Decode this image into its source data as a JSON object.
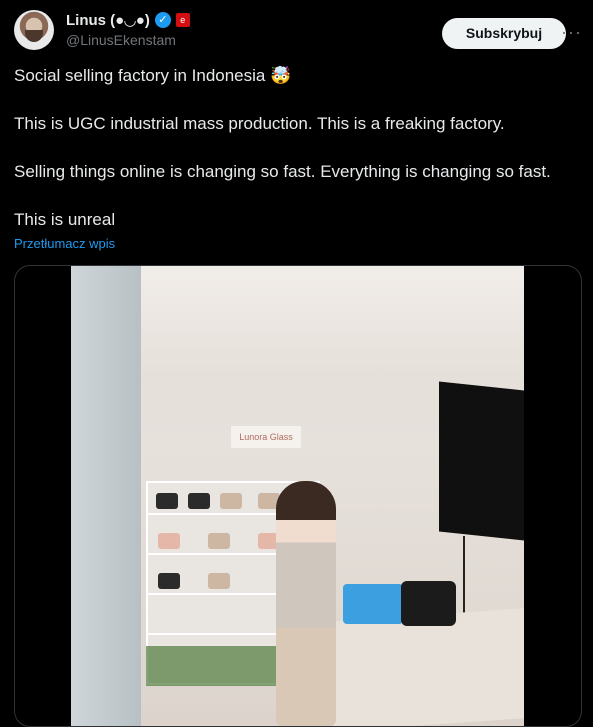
{
  "post": {
    "author_name": "Linus (●◡●)",
    "handle": "@LinusEkenstam",
    "subscribe_label": "Subskrybuj",
    "more_label": "···",
    "verified_mark": "✓",
    "affiliation_badge": "e",
    "paragraphs": [
      "Social selling factory in Indonesia 🤯",
      "This is UGC industrial mass production. This is a freaking factory.",
      "Selling things online is changing so fast. Everything is changing so fast.",
      "This is unreal"
    ],
    "translate_label": "Przetłumacz wpis",
    "media": {
      "sign_text": "Lunora Glass"
    }
  },
  "colors": {
    "background": "#000000",
    "text": "#e7e9ea",
    "secondary": "#71767b",
    "link": "#1d9bf0",
    "verified": "#1d9bf0",
    "subscribe_bg": "#eff3f4"
  }
}
